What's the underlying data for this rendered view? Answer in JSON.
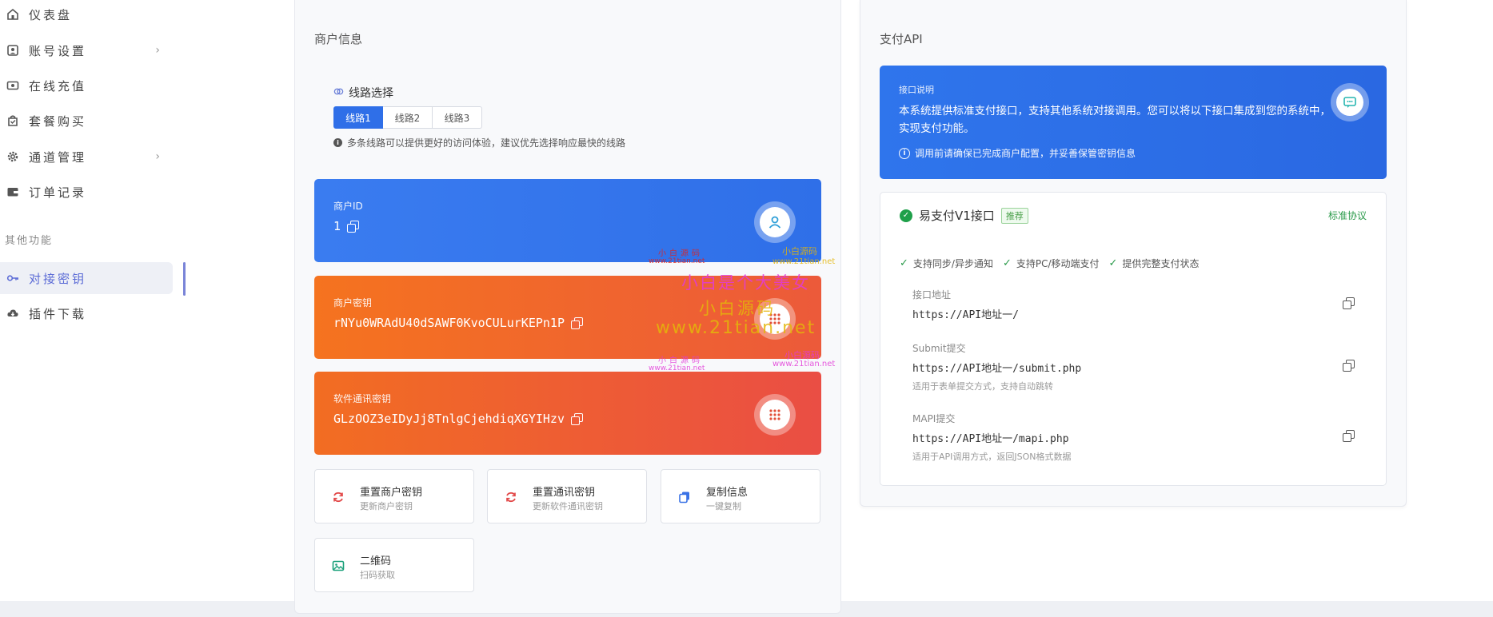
{
  "sidebar": {
    "items": [
      {
        "label": "仪表盘",
        "icon": "home-icon"
      },
      {
        "label": "账号设置",
        "icon": "user-card-icon",
        "has_children": true
      },
      {
        "label": "在线充值",
        "icon": "money-icon"
      },
      {
        "label": "套餐购买",
        "icon": "bag-icon"
      },
      {
        "label": "通道管理",
        "icon": "gear-icon",
        "has_children": true
      },
      {
        "label": "订单记录",
        "icon": "wallet-icon"
      }
    ],
    "section_title": "其他功能",
    "extra_items": [
      {
        "label": "对接密钥",
        "icon": "key-icon",
        "active": true
      },
      {
        "label": "插件下载",
        "icon": "cloud-download-icon"
      }
    ],
    "chevron": "›"
  },
  "merchant": {
    "title": "商户信息",
    "route": {
      "label": "线路选择",
      "tabs": [
        "线路1",
        "线路2",
        "线路3"
      ],
      "selected": "线路1",
      "hint": "多条线路可以提供更好的访问体验，建议优先选择响应最快的线路"
    },
    "cards": [
      {
        "label": "商户ID",
        "value": "1"
      },
      {
        "label": "商户密钥",
        "value": "rNYu0WRAdU40dSAWF0KvoCULurKEPn1P"
      },
      {
        "label": "软件通讯密钥",
        "value": "GLzOOZ3eIDyJj8TnlgCjehdiqXGYIHzv"
      }
    ],
    "actions": [
      {
        "title": "重置商户密钥",
        "sub": "更新商户密钥"
      },
      {
        "title": "重置通讯密钥",
        "sub": "更新软件通讯密钥"
      },
      {
        "title": "复制信息",
        "sub": "一键复制"
      },
      {
        "title": "二维码",
        "sub": "扫码获取"
      }
    ]
  },
  "watermark": {
    "small1": "小白源码",
    "small1_url": "www.21tian.net",
    "small2": "小白源码",
    "small2_url": "www.21tian.net",
    "big1": "小白是个大美女",
    "big2": "小白源码",
    "big3": "www.21tian.net",
    "small3": "小白源码",
    "small3_url": "www.21tian.net",
    "small4": "小白源码",
    "small4_url": "www.21tian.net"
  },
  "api": {
    "title": "支付API",
    "info": {
      "label": "接口说明",
      "text": "本系统提供标准支付接口，支持其他系统对接调用。您可以将以下接口集成到您的系统中，实现支付功能。",
      "notice": "调用前请确保已完成商户配置，并妥善保管密钥信息"
    },
    "detail": {
      "name": "易支付V1接口",
      "badge": "推荐",
      "protocol": "标准协议",
      "features": [
        "支持同步/异步通知",
        "支持PC/移动端支付",
        "提供完整支付状态"
      ],
      "endpoints": [
        {
          "label": "接口地址",
          "url": "https://API地址一/",
          "desc": ""
        },
        {
          "label": "Submit提交",
          "url": "https://API地址一/submit.php",
          "desc": "适用于表单提交方式，支持自动跳转"
        },
        {
          "label": "MAPI提交",
          "url": "https://API地址一/mapi.php",
          "desc": "适用于API调用方式，返回JSON格式数据"
        }
      ]
    }
  },
  "colors": {
    "primary": "#2f6fe8",
    "orange": "#f5731f",
    "red_orange": "#ea4e44",
    "success": "#1fa04a",
    "active_nav": "#5b6bd6"
  }
}
